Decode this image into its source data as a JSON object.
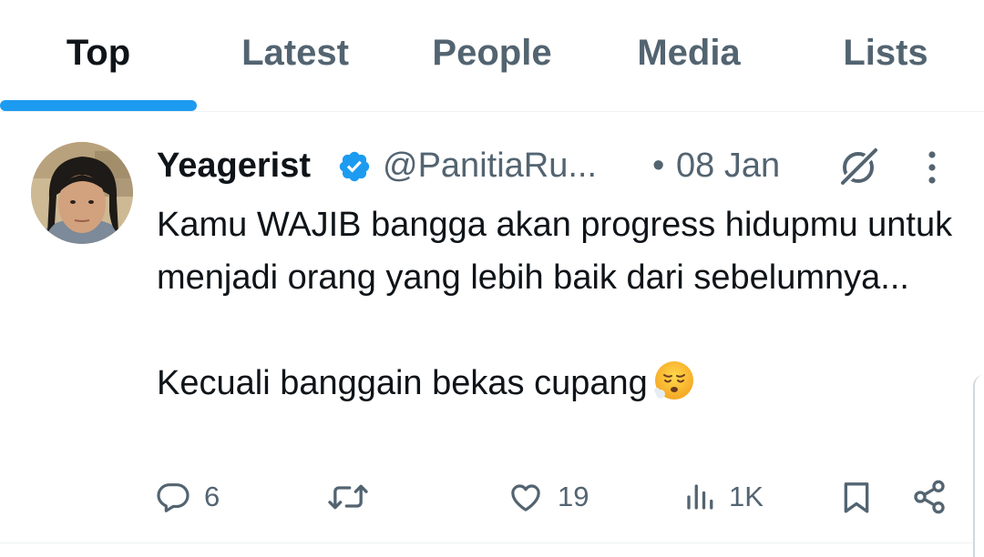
{
  "tabs": [
    {
      "label": "Top",
      "active": true
    },
    {
      "label": "Latest",
      "active": false
    },
    {
      "label": "People",
      "active": false
    },
    {
      "label": "Media",
      "active": false
    },
    {
      "label": "Lists",
      "active": false
    }
  ],
  "tweet": {
    "display_name": "Yeagerist",
    "verified": true,
    "handle": "@PanitiaRu...",
    "separator": "•",
    "date": "08 Jan",
    "text": "Kamu WAJIB bangga akan progress hidupmu untuk menjadi orang yang lebih baik dari sebelumnya...\n\nKecuali banggain bekas cupang",
    "emoji": "face-exhaling-emoji",
    "icons": {
      "verified": "verified-badge-icon",
      "grok": "grok-icon",
      "more": "more-vertical-icon"
    }
  },
  "actions": {
    "reply": {
      "icon": "reply-icon",
      "count": "6"
    },
    "retweet": {
      "icon": "retweet-icon",
      "count": ""
    },
    "like": {
      "icon": "heart-icon",
      "count": "19"
    },
    "views": {
      "icon": "views-icon",
      "count": "1K"
    },
    "bookmark": {
      "icon": "bookmark-icon"
    },
    "share": {
      "icon": "share-icon"
    }
  },
  "colors": {
    "accent": "#1d9bf0",
    "text_primary": "#0f1419",
    "text_secondary": "#536471",
    "divider": "#eff3f4"
  }
}
